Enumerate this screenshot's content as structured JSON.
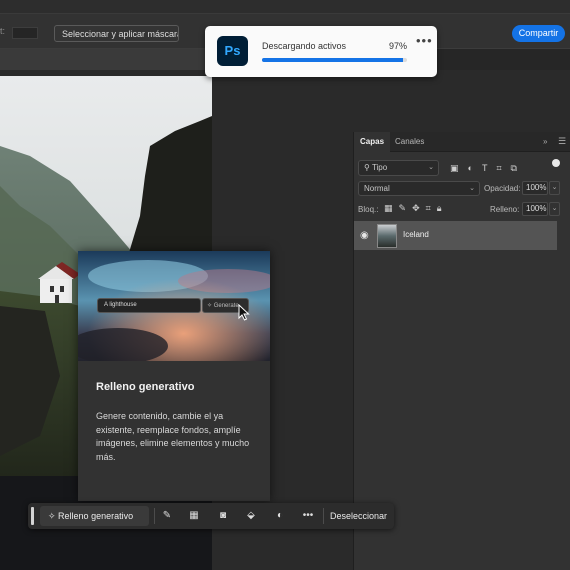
{
  "options_bar": {
    "left_label": "t:",
    "mask_button": "Seleccionar y aplicar máscara...",
    "share_button": "Compartir"
  },
  "download": {
    "app_logo": "Ps",
    "label": "Descargando activos",
    "percent_text": "97%",
    "progress": 0.97,
    "more_icon": "ellipsis-icon"
  },
  "layers_panel": {
    "tabs": [
      "Capas",
      "Canales"
    ],
    "filter": {
      "value": "Tipo"
    },
    "blend_mode": "Normal",
    "opacity_label": "Opacidad:",
    "opacity_value": "100%",
    "lock_label": "Bloq.:",
    "fill_label": "Relleno:",
    "fill_value": "100%",
    "layers": [
      {
        "name": "Iceland",
        "visible": true
      }
    ]
  },
  "generative_card": {
    "prompt_text": "A lighthouse",
    "generate_label": "Generate",
    "title": "Relleno generativo",
    "description": "Genere contenido, cambie el ya existente, reemplace fondos, amplíe imágenes, elimine elementos y mucho más."
  },
  "taskbar": {
    "generative_fill": "Relleno generativo",
    "deselect": "Deseleccionar",
    "icons": [
      "brush-icon",
      "transparency-icon",
      "mask-icon",
      "paint-bucket-icon",
      "adjustment-icon",
      "ellipsis-icon"
    ]
  },
  "colors": {
    "accent": "#1473e6",
    "ps_logo_bg": "#001e36",
    "ps_logo_fg": "#31a8ff"
  }
}
